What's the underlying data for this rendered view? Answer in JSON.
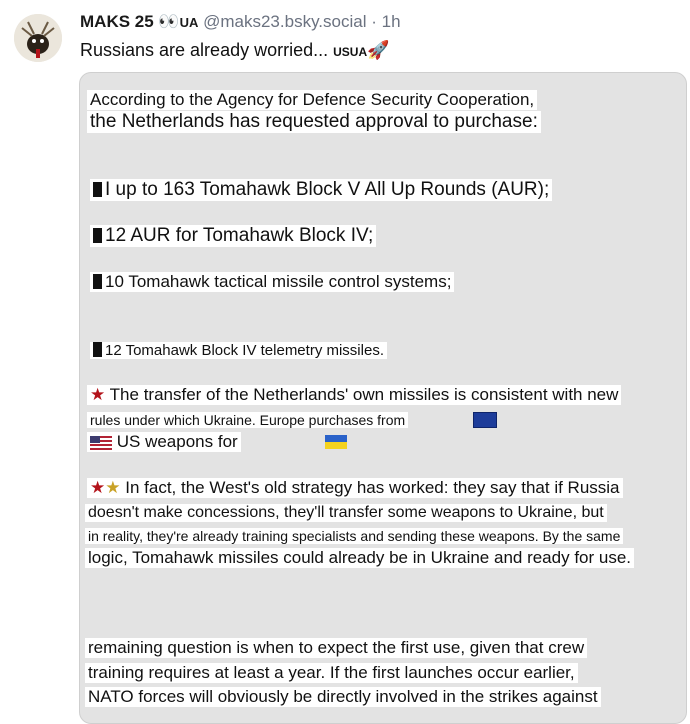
{
  "post": {
    "author_name": "MAKS 25",
    "eyes": "👀",
    "author_flag": "UA",
    "handle": "@maks23.bsky.social",
    "separator": "·",
    "time": "1h",
    "text": "Russians are already worried...",
    "text_suffix": "USUA",
    "rocket": "🚀"
  },
  "embed": {
    "lines": [
      "According to the Agency for Defence Security Cooperation,",
      "the Netherlands has requested approval to purchase:",
      "I up to 163 Tomahawk Block V All Up Rounds (AUR);",
      "12 AUR for Tomahawk Block IV;",
      "10 Tomahawk tactical missile control systems;",
      "12 Tomahawk Block IV telemetry missiles.",
      "The transfer of the Netherlands' own missiles is consistent with new",
      "rules under which Ukraine. Europe purchases from",
      "US weapons for",
      "In fact, the West's old strategy has worked: they say that if Russia",
      "doesn't make concessions, they'll transfer some weapons to Ukraine, but",
      "in reality, they're already training specialists and sending these weapons. By the same",
      "logic, Tomahawk missiles could already be in Ukraine and ready for use.",
      "remaining question is when to expect the first use, given that crew",
      "training requires at least a year. If the first launches occur earlier,",
      "NATO forces will obviously be directly involved in the strikes against"
    ],
    "star_glyph": "★"
  }
}
